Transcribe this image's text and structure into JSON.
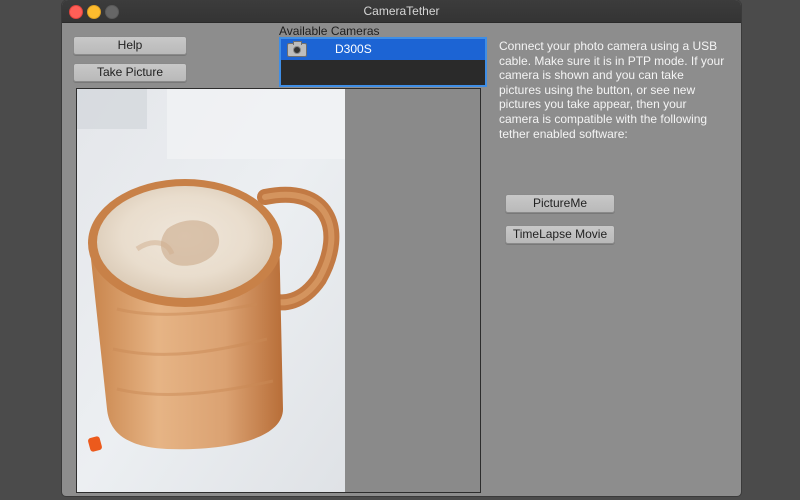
{
  "window": {
    "title": "CameraTether"
  },
  "buttons": {
    "help": "Help",
    "take_picture": "Take Picture",
    "picture_me": "PictureMe",
    "timelapse": "TimeLapse Movie"
  },
  "cameras": {
    "label": "Available Cameras",
    "items": [
      {
        "name": "D300S",
        "selected": true
      }
    ]
  },
  "info_text": "Connect your photo camera using a USB cable. Make sure it is in PTP mode. If your camera is shown and you can take pictures using the button, or see new pictures you take appear, then your camera is compatible with the following tether enabled software:",
  "colors": {
    "selection": "#1c64d4",
    "focus_ring": "#3f8ee6",
    "window_bg": "#8d8d8d",
    "close": "#ff5f57",
    "minimize": "#febc2e"
  }
}
